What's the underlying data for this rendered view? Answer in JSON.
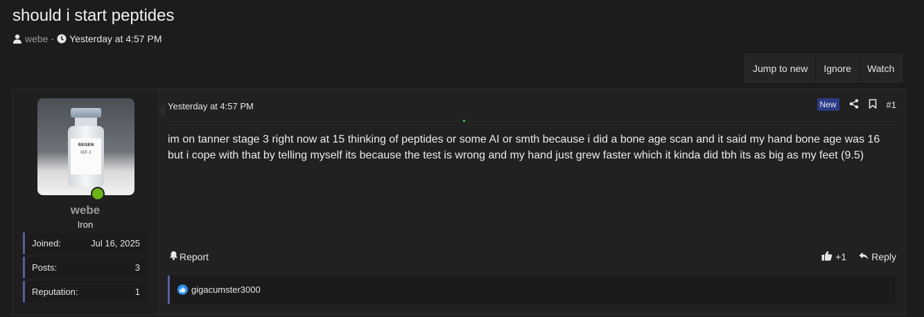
{
  "thread": {
    "title": "should i start peptides",
    "author": "webe",
    "separator": "·",
    "date": "Yesterday at 4:57 PM"
  },
  "toolbar": {
    "jump_label": "Jump to new",
    "ignore_label": "Ignore",
    "watch_label": "Watch"
  },
  "user": {
    "name": "webe",
    "title": "Iron",
    "avatar_brand": "REGEN",
    "avatar_label": "IGF-1",
    "stats": [
      {
        "label": "Joined:",
        "value": "Jul 16, 2025"
      },
      {
        "label": "Posts:",
        "value": "3"
      },
      {
        "label": "Reputation:",
        "value": "1"
      }
    ]
  },
  "post": {
    "date": "Yesterday at 4:57 PM",
    "badge": "New",
    "number": "#1",
    "message": "im on tanner stage 3 right now at 15 thinking of peptides or some AI or smth because i did a bone age scan and it said my hand bone age was 16 but i cope with that by telling myself its because the test is wrong and my hand just grew faster which it kinda did tbh its as big as my feet (9.5)",
    "report_label": "Report",
    "like_count": "+1",
    "reply_label": "Reply"
  },
  "reactions": {
    "user": "gigacumster3000"
  },
  "icons": {
    "author": "user-icon",
    "date": "clock-icon",
    "share": "share-icon",
    "bookmark": "bookmark-icon",
    "report": "bell-icon",
    "like": "thumbs-up-icon",
    "reply": "reply-icon"
  },
  "colors": {
    "background": "#1c1c1c",
    "accent": "#5a5f9e",
    "badge": "#2c3b85",
    "online": "#6bb317",
    "like": "#2e8ce8"
  }
}
